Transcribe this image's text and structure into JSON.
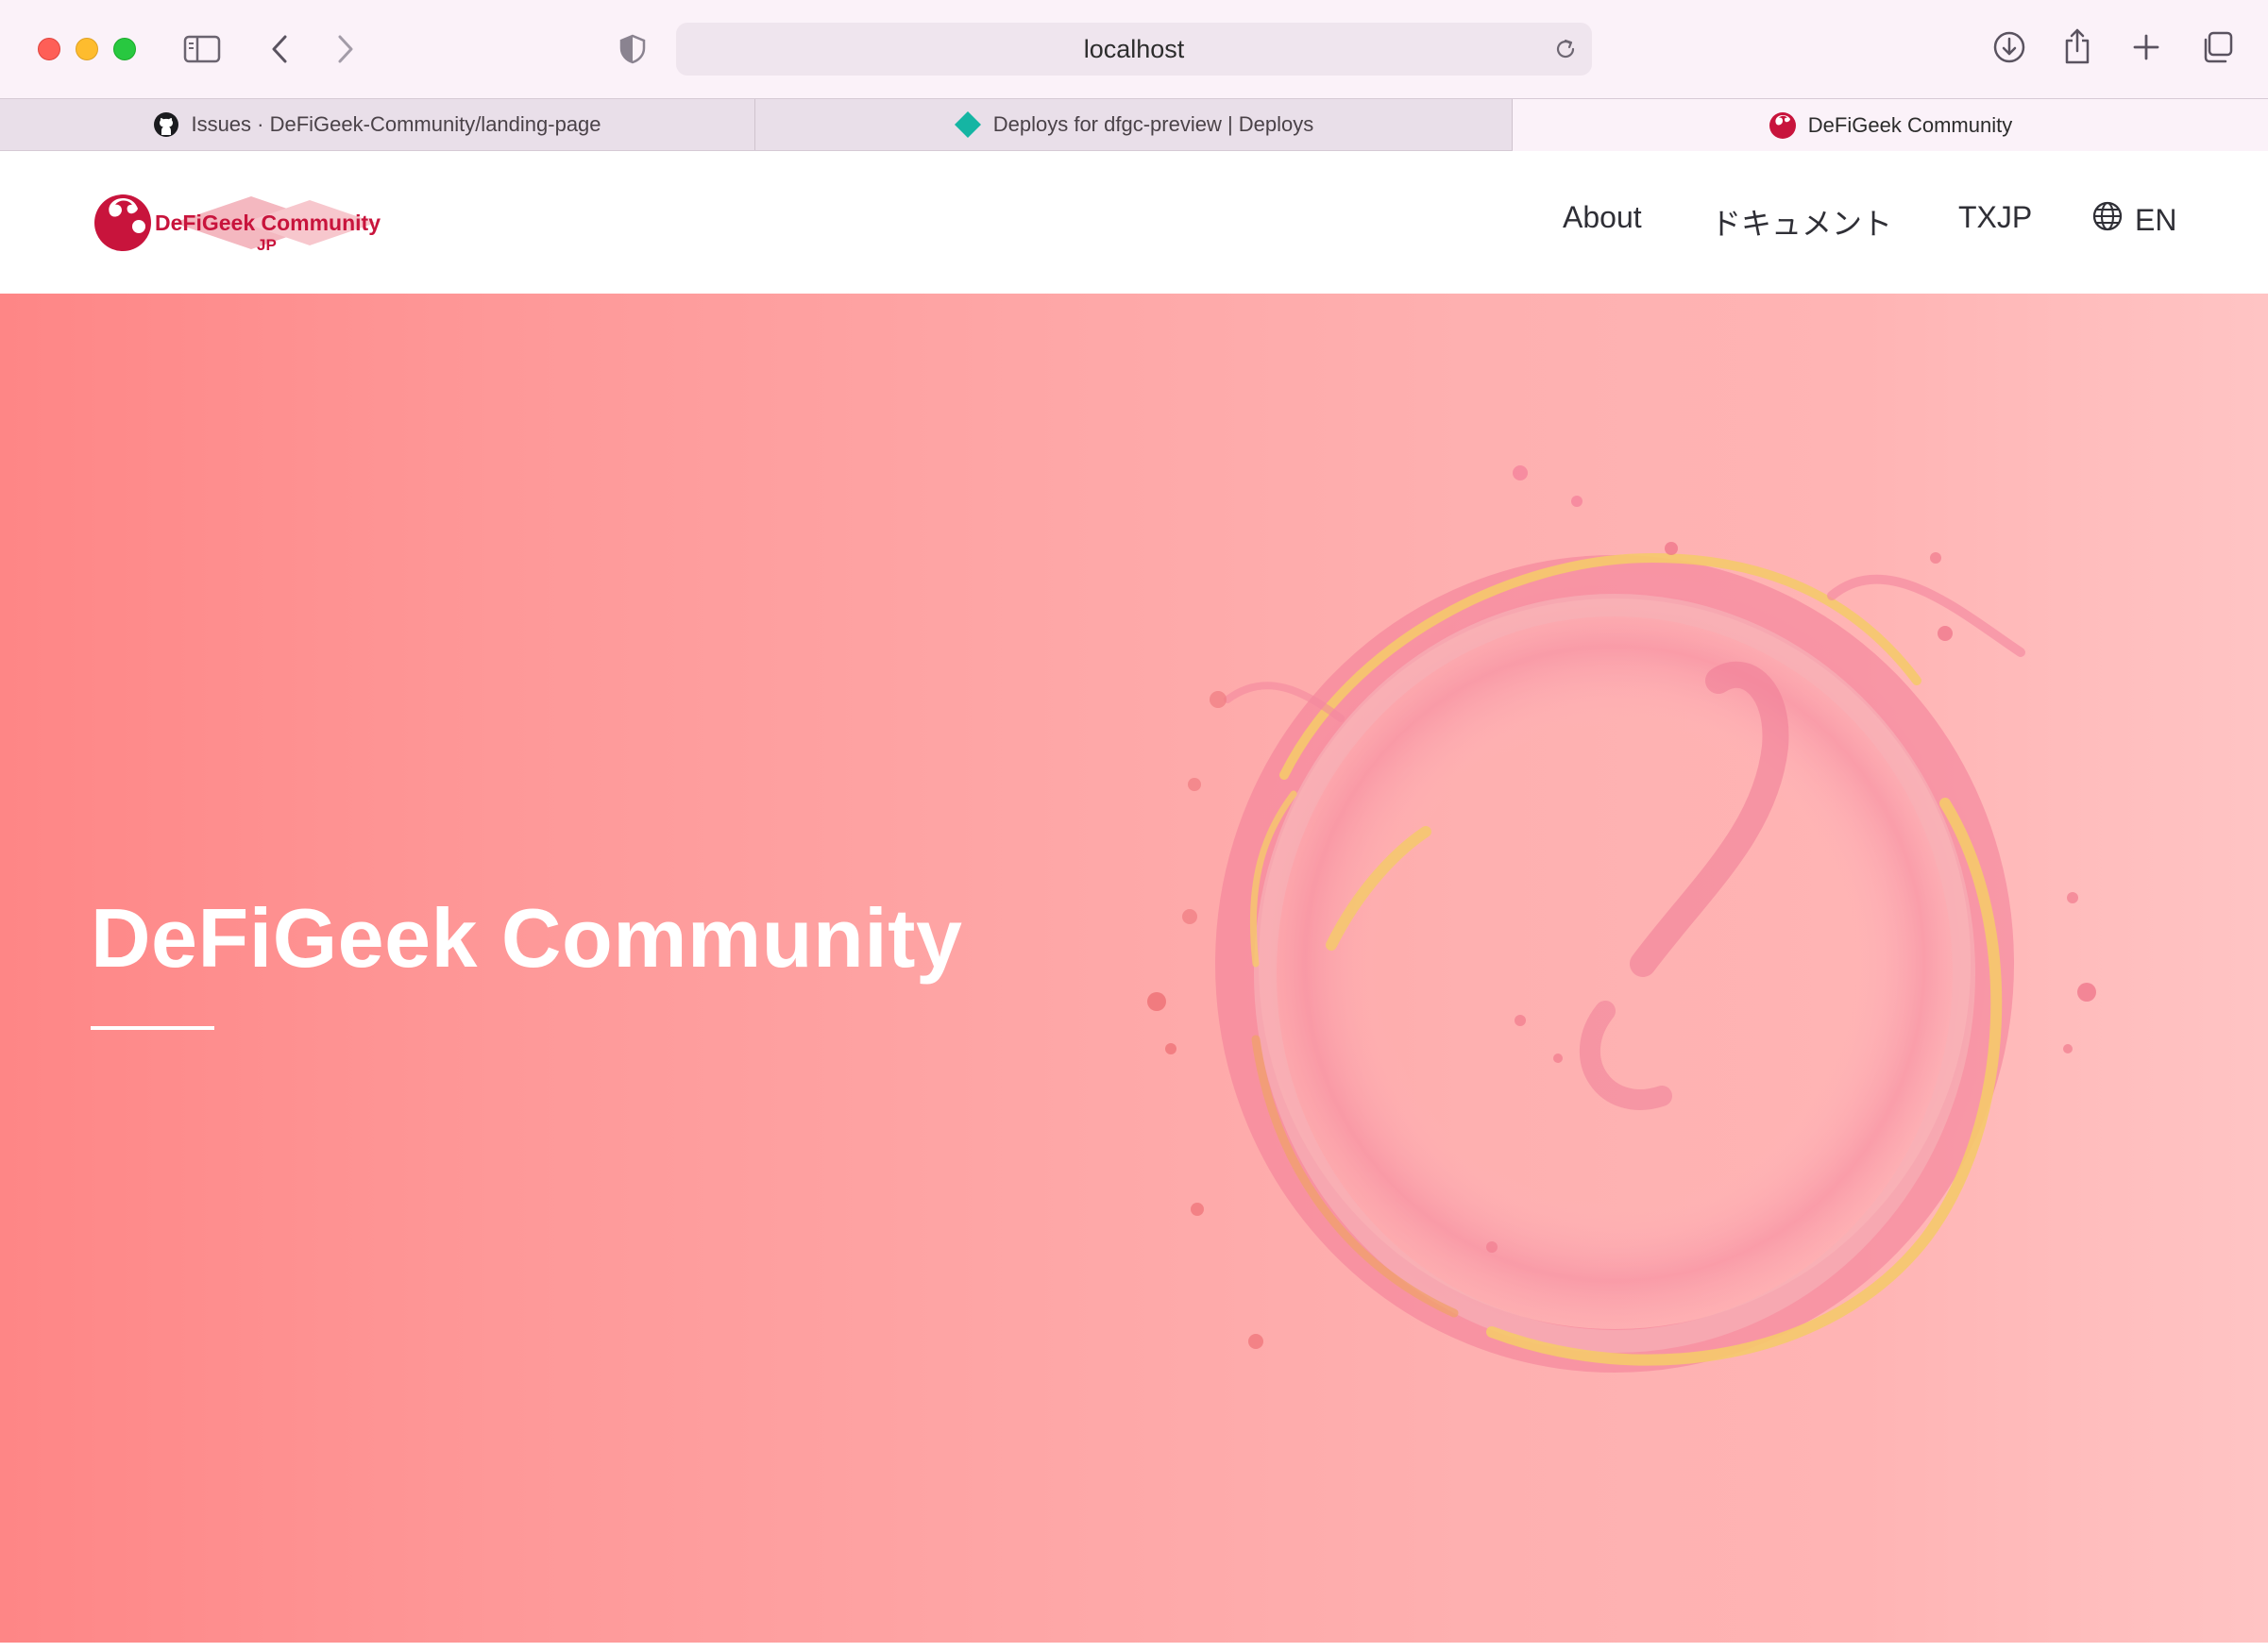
{
  "browser": {
    "address": "localhost",
    "tabs": [
      {
        "label": "Issues · DeFiGeek-Community/landing-page",
        "icon": "github-icon",
        "active": false
      },
      {
        "label": "Deploys for dfgc-preview | Deploys",
        "icon": "netlify-diamond-icon",
        "active": false
      },
      {
        "label": "DeFiGeek Community",
        "icon": "dfgc-favicon-icon",
        "active": true
      }
    ]
  },
  "header": {
    "logo_text": "DeFiGeek Community",
    "logo_sub": "JP",
    "nav": {
      "about": "About",
      "docs": "ドキュメント",
      "txjp": "TXJP",
      "lang": "EN"
    }
  },
  "hero": {
    "title": "DeFiGeek Community"
  },
  "colors": {
    "brand_red": "#c8143c",
    "hero_left": "#fe8686",
    "hero_right": "#ffc4c4",
    "chrome_bg": "#fbf2f9"
  }
}
